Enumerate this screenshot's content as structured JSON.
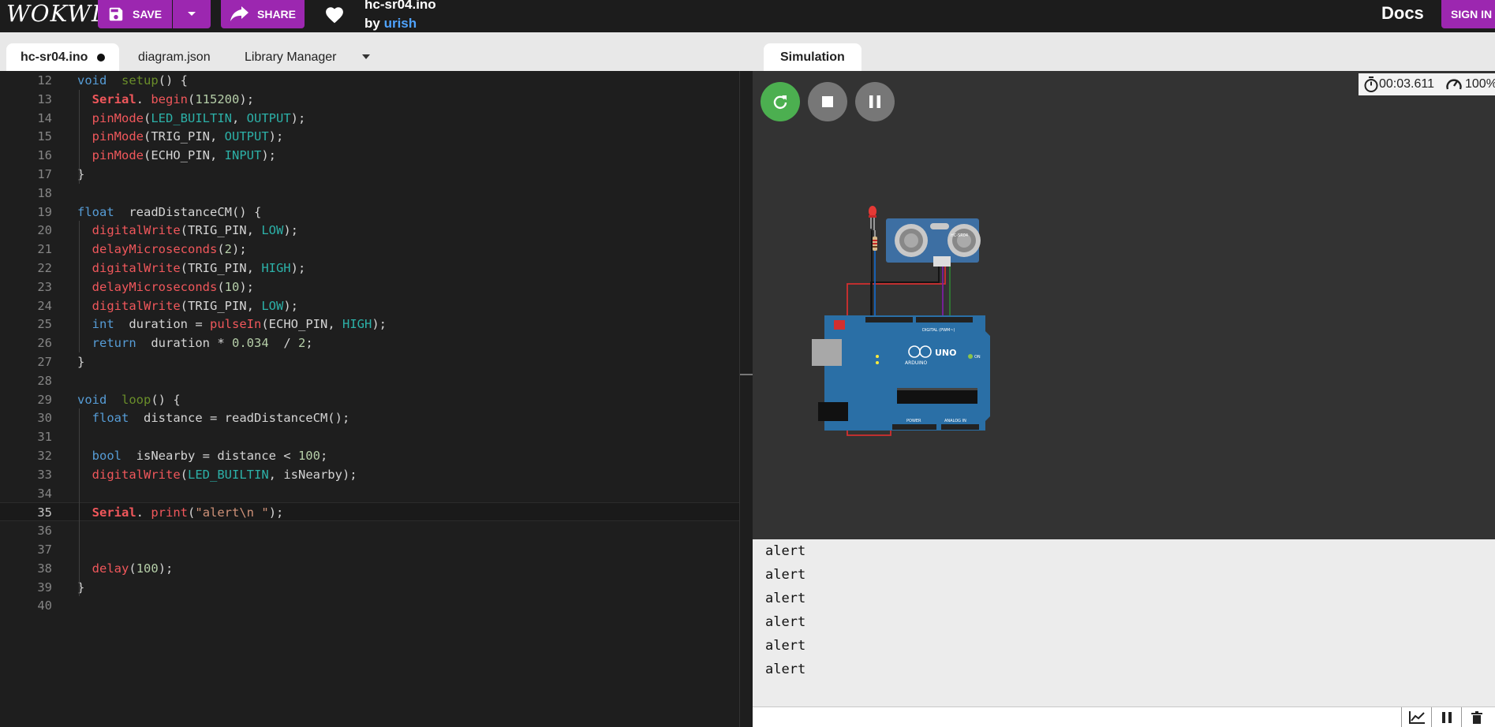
{
  "header": {
    "logo": "WOKWI",
    "save_label": "SAVE",
    "share_label": "SHARE",
    "project_title": "hc-sr04.ino",
    "by_label": "by",
    "author": "urish",
    "docs_label": "Docs",
    "signin_label": "SIGN IN"
  },
  "editor": {
    "tabs": [
      {
        "label": "hc-sr04.ino",
        "unsaved": true
      },
      {
        "label": "diagram.json"
      },
      {
        "label": "Library Manager"
      }
    ],
    "current_line": 35,
    "lines": [
      {
        "n": "12",
        "segs": [
          [
            "kw",
            "void"
          ],
          [
            "",
            "  "
          ],
          [
            "fn-loop",
            "setup"
          ],
          [
            "",
            "() {"
          ]
        ]
      },
      {
        "n": "13",
        "segs": [
          [
            "",
            "  "
          ],
          [
            "cls",
            "Serial"
          ],
          [
            "",
            ". "
          ],
          [
            "fn",
            "begin"
          ],
          [
            "",
            "("
          ],
          [
            "num",
            "115200"
          ],
          [
            "",
            ");"
          ]
        ]
      },
      {
        "n": "14",
        "segs": [
          [
            "",
            "  "
          ],
          [
            "fn",
            "pinMode"
          ],
          [
            "",
            "("
          ],
          [
            "const",
            "LED_BUILTIN"
          ],
          [
            "",
            ", "
          ],
          [
            "const",
            "OUTPUT"
          ],
          [
            "",
            ");"
          ]
        ]
      },
      {
        "n": "15",
        "segs": [
          [
            "",
            "  "
          ],
          [
            "fn",
            "pinMode"
          ],
          [
            "",
            "(TRIG_PIN, "
          ],
          [
            "const",
            "OUTPUT"
          ],
          [
            "",
            ");"
          ]
        ]
      },
      {
        "n": "16",
        "segs": [
          [
            "",
            "  "
          ],
          [
            "fn",
            "pinMode"
          ],
          [
            "",
            "(ECHO_PIN, "
          ],
          [
            "const",
            "INPUT"
          ],
          [
            "",
            ");"
          ]
        ]
      },
      {
        "n": "17",
        "segs": [
          [
            "",
            "}"
          ]
        ]
      },
      {
        "n": "18",
        "segs": []
      },
      {
        "n": "19",
        "segs": [
          [
            "kw",
            "float"
          ],
          [
            "",
            "  readDistanceCM() {"
          ]
        ]
      },
      {
        "n": "20",
        "segs": [
          [
            "",
            "  "
          ],
          [
            "fn",
            "digitalWrite"
          ],
          [
            "",
            "(TRIG_PIN, "
          ],
          [
            "const",
            "LOW"
          ],
          [
            "",
            ");"
          ]
        ]
      },
      {
        "n": "21",
        "segs": [
          [
            "",
            "  "
          ],
          [
            "fn",
            "delayMicroseconds"
          ],
          [
            "",
            "("
          ],
          [
            "num",
            "2"
          ],
          [
            "",
            ");"
          ]
        ]
      },
      {
        "n": "22",
        "segs": [
          [
            "",
            "  "
          ],
          [
            "fn",
            "digitalWrite"
          ],
          [
            "",
            "(TRIG_PIN, "
          ],
          [
            "const",
            "HIGH"
          ],
          [
            "",
            ");"
          ]
        ]
      },
      {
        "n": "23",
        "segs": [
          [
            "",
            "  "
          ],
          [
            "fn",
            "delayMicroseconds"
          ],
          [
            "",
            "("
          ],
          [
            "num",
            "10"
          ],
          [
            "",
            ");"
          ]
        ]
      },
      {
        "n": "24",
        "segs": [
          [
            "",
            "  "
          ],
          [
            "fn",
            "digitalWrite"
          ],
          [
            "",
            "(TRIG_PIN, "
          ],
          [
            "const",
            "LOW"
          ],
          [
            "",
            ");"
          ]
        ]
      },
      {
        "n": "25",
        "segs": [
          [
            "",
            "  "
          ],
          [
            "kw",
            "int"
          ],
          [
            "",
            "  duration = "
          ],
          [
            "fn",
            "pulseIn"
          ],
          [
            "",
            "(ECHO_PIN, "
          ],
          [
            "const",
            "HIGH"
          ],
          [
            "",
            ");"
          ]
        ]
      },
      {
        "n": "26",
        "segs": [
          [
            "",
            "  "
          ],
          [
            "kw",
            "return"
          ],
          [
            "",
            "  duration * "
          ],
          [
            "num",
            "0.034"
          ],
          [
            "",
            "  / "
          ],
          [
            "num",
            "2"
          ],
          [
            "",
            ";"
          ]
        ]
      },
      {
        "n": "27",
        "segs": [
          [
            "",
            "}"
          ]
        ]
      },
      {
        "n": "28",
        "segs": []
      },
      {
        "n": "29",
        "segs": [
          [
            "kw",
            "void"
          ],
          [
            "",
            "  "
          ],
          [
            "fn-loop",
            "loop"
          ],
          [
            "",
            "() {"
          ]
        ]
      },
      {
        "n": "30",
        "segs": [
          [
            "",
            "  "
          ],
          [
            "kw",
            "float"
          ],
          [
            "",
            "  distance = readDistanceCM();"
          ]
        ]
      },
      {
        "n": "31",
        "segs": []
      },
      {
        "n": "32",
        "segs": [
          [
            "",
            "  "
          ],
          [
            "kw",
            "bool"
          ],
          [
            "",
            "  isNearby = distance < "
          ],
          [
            "num",
            "100"
          ],
          [
            "",
            ";"
          ]
        ]
      },
      {
        "n": "33",
        "segs": [
          [
            "",
            "  "
          ],
          [
            "fn",
            "digitalWrite"
          ],
          [
            "",
            "("
          ],
          [
            "const",
            "LED_BUILTIN"
          ],
          [
            "",
            ", isNearby);"
          ]
        ]
      },
      {
        "n": "34",
        "segs": []
      },
      {
        "n": "35",
        "segs": [
          [
            "",
            "  "
          ],
          [
            "cls",
            "Serial"
          ],
          [
            "",
            ". "
          ],
          [
            "fn",
            "print"
          ],
          [
            "",
            "("
          ],
          [
            "str",
            "\"alert\\n \""
          ],
          [
            "",
            ");"
          ]
        ]
      },
      {
        "n": "36",
        "segs": []
      },
      {
        "n": "37",
        "segs": []
      },
      {
        "n": "38",
        "segs": [
          [
            "",
            "  "
          ],
          [
            "fn",
            "delay"
          ],
          [
            "",
            "("
          ],
          [
            "num",
            "100"
          ],
          [
            "",
            ");"
          ]
        ]
      },
      {
        "n": "39",
        "segs": [
          [
            "",
            "}"
          ]
        ]
      },
      {
        "n": "40",
        "segs": []
      }
    ]
  },
  "simulation": {
    "tab_label": "Simulation",
    "elapsed": "00:03.611",
    "speed": "100%",
    "board_labels": {
      "uno": "UNO",
      "arduino": "ARDUINO",
      "digital": "DIGITAL (PWM~)",
      "sensor": "HC-SR04",
      "on": "ON",
      "power": "POWER",
      "analog": "ANALOG IN"
    }
  },
  "serial_monitor": {
    "lines": [
      "alert",
      "alert",
      "alert",
      "alert",
      "alert",
      "alert"
    ]
  },
  "colors": {
    "accent": "#9c27b0",
    "run_green": "#4caf50",
    "editor_bg": "#1e1e1e"
  }
}
